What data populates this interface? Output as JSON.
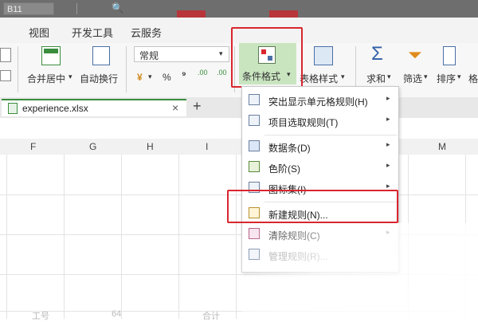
{
  "titlebar": {
    "namebox": "B11",
    "fx_icon": "function-icon"
  },
  "menubar": {
    "tabs": [
      "视图",
      "开发工具",
      "云服务"
    ]
  },
  "ribbon": {
    "merge_center": "合并居中",
    "wrap_text": "自动换行",
    "number_format": "常规",
    "currency_symbol": "¥",
    "percent_symbol": "%",
    "comma_symbol": "⁹",
    "decimal_increase": ".00",
    "decimal_decrease": ".00",
    "conditional_format": "条件格式",
    "table_style": "表格样式",
    "sum": "求和",
    "filter": "筛选",
    "sort": "排序",
    "more": "格",
    "sum_glyph": "Σ"
  },
  "file_tab": {
    "name": "experience.xlsx",
    "close": "×",
    "new": "+"
  },
  "columns": [
    "F",
    "G",
    "H",
    "I",
    "M"
  ],
  "bottom_row_faint": [
    "工号",
    "64",
    "合计"
  ],
  "dropdown": {
    "items": [
      {
        "label": "突出显示单元格规则(H)",
        "icon": "highlight-rules-icon",
        "submenu": true
      },
      {
        "label": "项目选取规则(T)",
        "icon": "top-bottom-rules-icon",
        "submenu": true
      },
      {
        "label": "数据条(D)",
        "icon": "data-bars-icon",
        "submenu": true
      },
      {
        "label": "色阶(S)",
        "icon": "color-scales-icon",
        "submenu": true
      },
      {
        "label": "图标集(I)",
        "icon": "icon-sets-icon",
        "submenu": true
      },
      {
        "label": "新建规则(N)...",
        "icon": "new-rule-icon",
        "submenu": false
      },
      {
        "label": "清除规则(C)",
        "icon": "clear-rules-icon",
        "submenu": true
      },
      {
        "label": "管理规则(R)...",
        "icon": "manage-rules-icon",
        "submenu": false
      }
    ]
  },
  "colors": {
    "accent_red": "#d9262f",
    "sheet_green": "#3a8d3d",
    "ribbon_bg": "#f7f7f7",
    "active_button_bg": "#c9e5c0"
  }
}
